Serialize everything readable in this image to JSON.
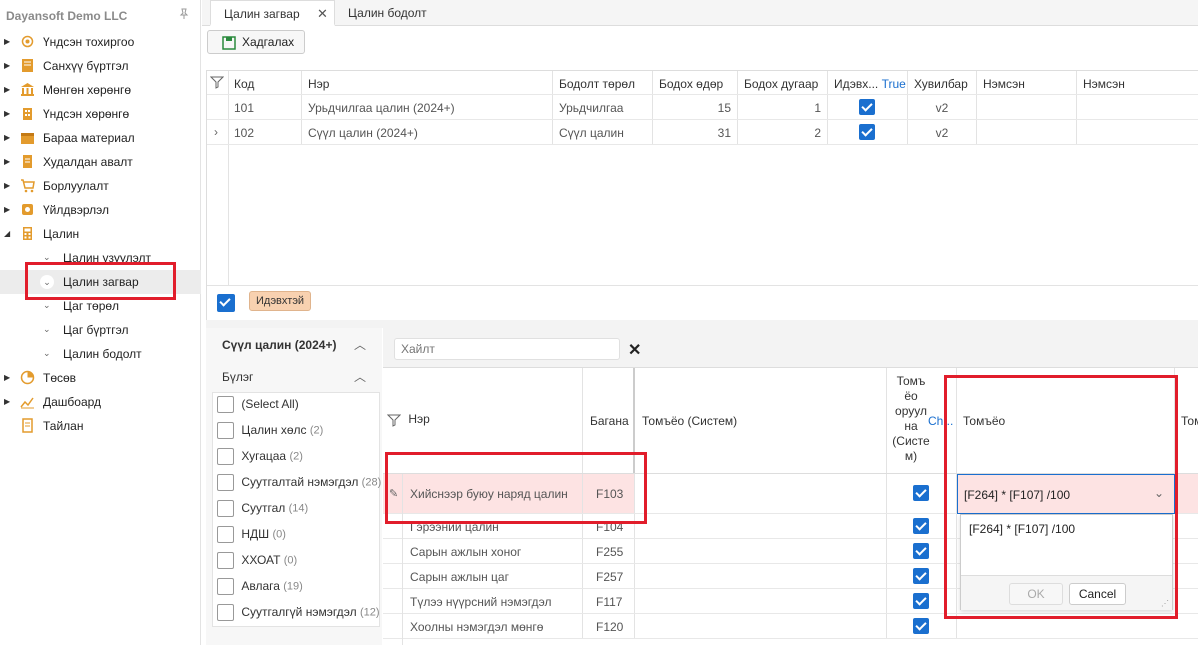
{
  "sidebar": {
    "company": "Dayansoft Demo LLC",
    "items": [
      {
        "label": "Үндсэн тохиргоо",
        "icon": "gear-icon"
      },
      {
        "label": "Санхүү бүртгэл",
        "icon": "ledger-icon"
      },
      {
        "label": "Мөнгөн хөрөнгө",
        "icon": "bank-icon"
      },
      {
        "label": "Үндсэн хөрөнгө",
        "icon": "building-icon"
      },
      {
        "label": "Бараа материал",
        "icon": "box-icon"
      },
      {
        "label": "Худалдан авалт",
        "icon": "document-icon"
      },
      {
        "label": "Борлуулалт",
        "icon": "cart-icon"
      },
      {
        "label": "Үйлдвэрлэл",
        "icon": "factory-icon"
      },
      {
        "label": "Цалин",
        "icon": "calculator-icon"
      }
    ],
    "sub_items": [
      "Цалин узуулэлт",
      "Цалин загвар",
      "Цаг төрөл",
      "Цаг бүртгэл",
      "Цалин бодолт"
    ],
    "bottom_items": [
      {
        "label": "Төсөв",
        "icon": "pie-chart-icon"
      },
      {
        "label": "Дашбоард",
        "icon": "dashboard-icon"
      },
      {
        "label": "Тайлан",
        "icon": "report-icon"
      }
    ]
  },
  "tabs": {
    "active": "Цалин загвар",
    "other": "Цалин бодолт"
  },
  "toolbar": {
    "save_label": "Хадгалах"
  },
  "top_grid": {
    "headers": [
      "Код",
      "Нэр",
      "Бодолт төрөл",
      "Бодох өдөр",
      "Бодох дугаар",
      "Идэвх...",
      "True",
      "Хувилбар",
      "Нэмсэн",
      "Нэмсэн"
    ],
    "rows": [
      {
        "code": "101",
        "name": "Урьдчилгаа цалин (2024+)",
        "type": "Урьдчилгаа",
        "day": "15",
        "number": "1",
        "version": "v2"
      },
      {
        "code": "102",
        "name": "Сүүл цалин (2024+)",
        "type": "Сүүл цалин",
        "day": "31",
        "number": "2",
        "version": "v2"
      }
    ],
    "filter_tag": "Идэвхтэй"
  },
  "filter_panel": {
    "title": "Сүүл цалин (2024+)",
    "group_label": "Бүлэг",
    "options": [
      {
        "label": "(Select All)",
        "count": ""
      },
      {
        "label": "Цалин хөлс",
        "count": "(2)"
      },
      {
        "label": "Хугацаа",
        "count": "(2)"
      },
      {
        "label": "Суутгалтай нэмэгдэл",
        "count": "(28)"
      },
      {
        "label": "Суутгал",
        "count": "(14)"
      },
      {
        "label": "НДШ",
        "count": "(0)"
      },
      {
        "label": "ХХОАТ",
        "count": "(0)"
      },
      {
        "label": "Авлага",
        "count": "(19)"
      },
      {
        "label": "Суутгалгүй нэмэгдэл",
        "count": "(12)"
      }
    ]
  },
  "bottom_grid": {
    "search_placeholder": "Хайлт",
    "headers": {
      "name": "Нэр",
      "column": "Багана",
      "formula_sys": "Томъёо (Систем)",
      "formula_included": "Томъ ёо оруул на (Систе м)",
      "ch": "Ch...",
      "formula": "Томъёо",
      "more": "Том"
    },
    "rows": [
      {
        "name": "Хийснээр буюу наряд цалин",
        "col": "F103"
      },
      {
        "name": "Гэрээний цалин",
        "col": "F104"
      },
      {
        "name": "Сарын ажлын хоног",
        "col": "F255"
      },
      {
        "name": "Сарын ажлын цаг",
        "col": "F257"
      },
      {
        "name": "Түлээ нүүрсний нэмэгдэл",
        "col": "F117"
      },
      {
        "name": "Хоолны нэмэгдэл мөнгө",
        "col": "F120"
      }
    ],
    "editor": {
      "value": "[F264] * [F107] /100",
      "popup_text": "[F264] * [F107] /100",
      "ok": "OK",
      "cancel": "Cancel"
    }
  },
  "colors": {
    "accent": "#1a6fcf",
    "highlight": "#e11d2b",
    "edit_row": "#fde3e3",
    "tag": "#f8d1b0"
  }
}
